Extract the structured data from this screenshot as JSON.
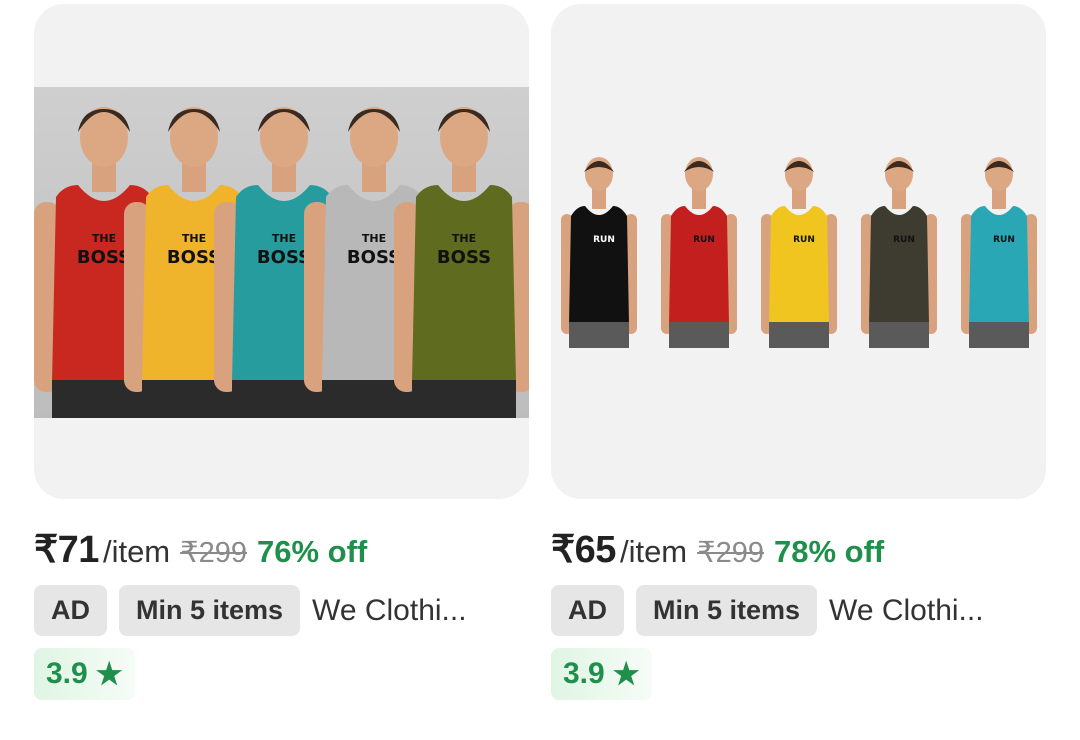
{
  "products": [
    {
      "price": "₹71",
      "unit": "/item",
      "mrp": "₹299",
      "discount": "76% off",
      "ad_label": "AD",
      "min_label": "Min 5 items",
      "seller": "We Clothi...",
      "rating": "3.9",
      "image_print": "THE BOSS",
      "vest_colors": [
        "#c8281f",
        "#f0b32c",
        "#279c9f",
        "#b8b8b8",
        "#5f6b1f"
      ]
    },
    {
      "price": "₹65",
      "unit": "/item",
      "mrp": "₹299",
      "discount": "78% off",
      "ad_label": "AD",
      "min_label": "Min 5 items",
      "seller": "We Clothi...",
      "rating": "3.9",
      "image_print": "RUN",
      "vest_colors": [
        "#111111",
        "#c41f1f",
        "#f1c51f",
        "#3e3b30",
        "#2aa7b4"
      ]
    }
  ],
  "icons": {
    "rating_star": "star-icon"
  },
  "colors": {
    "discount": "#1f8f4b",
    "rating_bg": "#dff5e4"
  }
}
